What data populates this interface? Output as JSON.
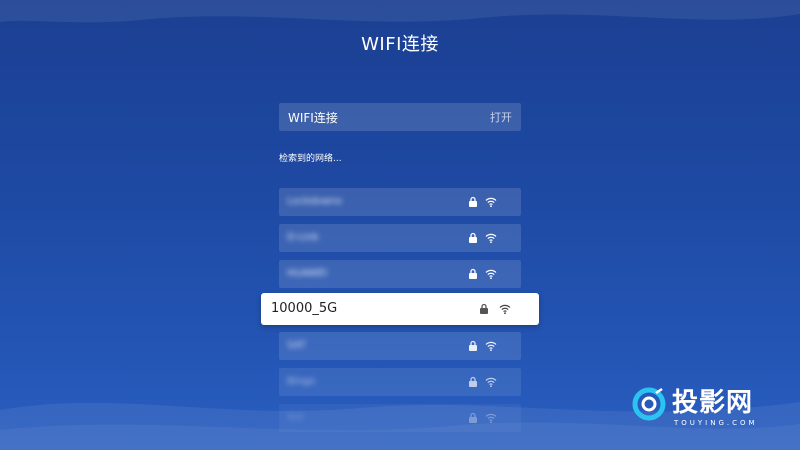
{
  "header": {
    "title": "WIFI连接"
  },
  "wifi_toggle": {
    "label": "WIFI连接",
    "state": "打开"
  },
  "networks_section": {
    "label": "检索到的网络..."
  },
  "networks": [
    {
      "ssid": "Lockdowns",
      "secured": true,
      "selected": false
    },
    {
      "ssid": "D-Link",
      "secured": true,
      "selected": false
    },
    {
      "ssid": "HUAWEI",
      "secured": true,
      "selected": false
    },
    {
      "ssid": "10000_5G",
      "secured": true,
      "selected": true
    },
    {
      "ssid": "SAT",
      "secured": true,
      "selected": false
    },
    {
      "ssid": "Bingo",
      "secured": true,
      "selected": false
    },
    {
      "ssid": "Net",
      "secured": true,
      "selected": false
    }
  ],
  "icons": {
    "lock": "lock-icon",
    "signal": "wifi-signal-icon"
  },
  "colors": {
    "background": "#1e4aa4",
    "selected_row": "#ffffff",
    "selected_text": "#222222"
  },
  "watermark": {
    "brand": "投影网",
    "brand_sub": "TOUYING.COM"
  }
}
